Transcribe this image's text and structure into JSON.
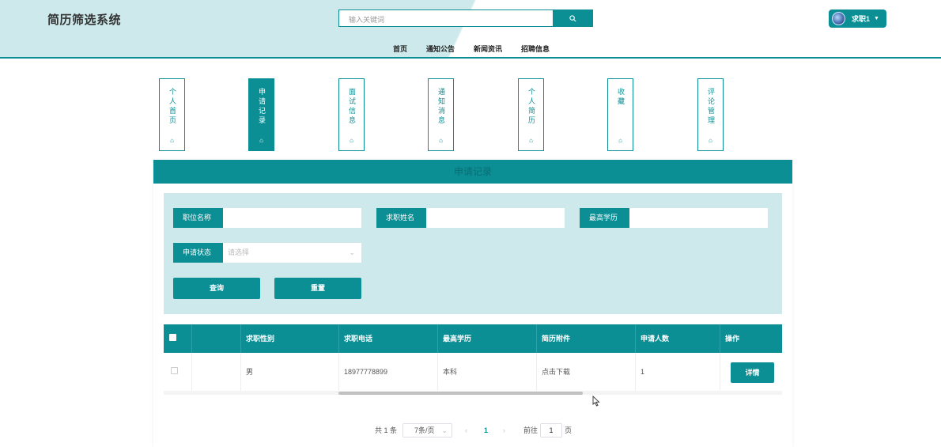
{
  "header": {
    "logo": "简历筛选系统",
    "search_placeholder": "输入关键词",
    "user_name": "求职1",
    "nav": [
      "首页",
      "通知公告",
      "新闻资讯",
      "招聘信息"
    ]
  },
  "side_menu": [
    {
      "label": "个人首页",
      "active": false
    },
    {
      "label": "申请记录",
      "active": true
    },
    {
      "label": "面试信息",
      "active": false
    },
    {
      "label": "通知消息",
      "active": false
    },
    {
      "label": "个人简历",
      "active": false
    },
    {
      "label": "收藏",
      "active": false
    },
    {
      "label": "评论管理",
      "active": false
    }
  ],
  "panel": {
    "title": "申请记录"
  },
  "filter": {
    "job_name_label": "职位名称",
    "applicant_name_label": "求职姓名",
    "education_label": "最高学历",
    "status_label": "申请状态",
    "status_placeholder": "请选择",
    "query_button": "查询",
    "reset_button": "重置"
  },
  "table": {
    "headers": [
      "",
      "求职性别",
      "求职电话",
      "最高学历",
      "简历附件",
      "申请人数",
      "操作"
    ],
    "rows": [
      {
        "gender": "男",
        "phone": "18977778899",
        "education": "本科",
        "attachment": "点击下载",
        "count": "1",
        "action": "详情"
      }
    ]
  },
  "pagination": {
    "total": "共 1 条",
    "page_size": "7条/页",
    "current_page": "1",
    "goto_label": "前往",
    "goto_value": "1",
    "page_suffix": "页"
  },
  "colors": {
    "primary": "#0b8f95",
    "light": "#cde9eb"
  }
}
